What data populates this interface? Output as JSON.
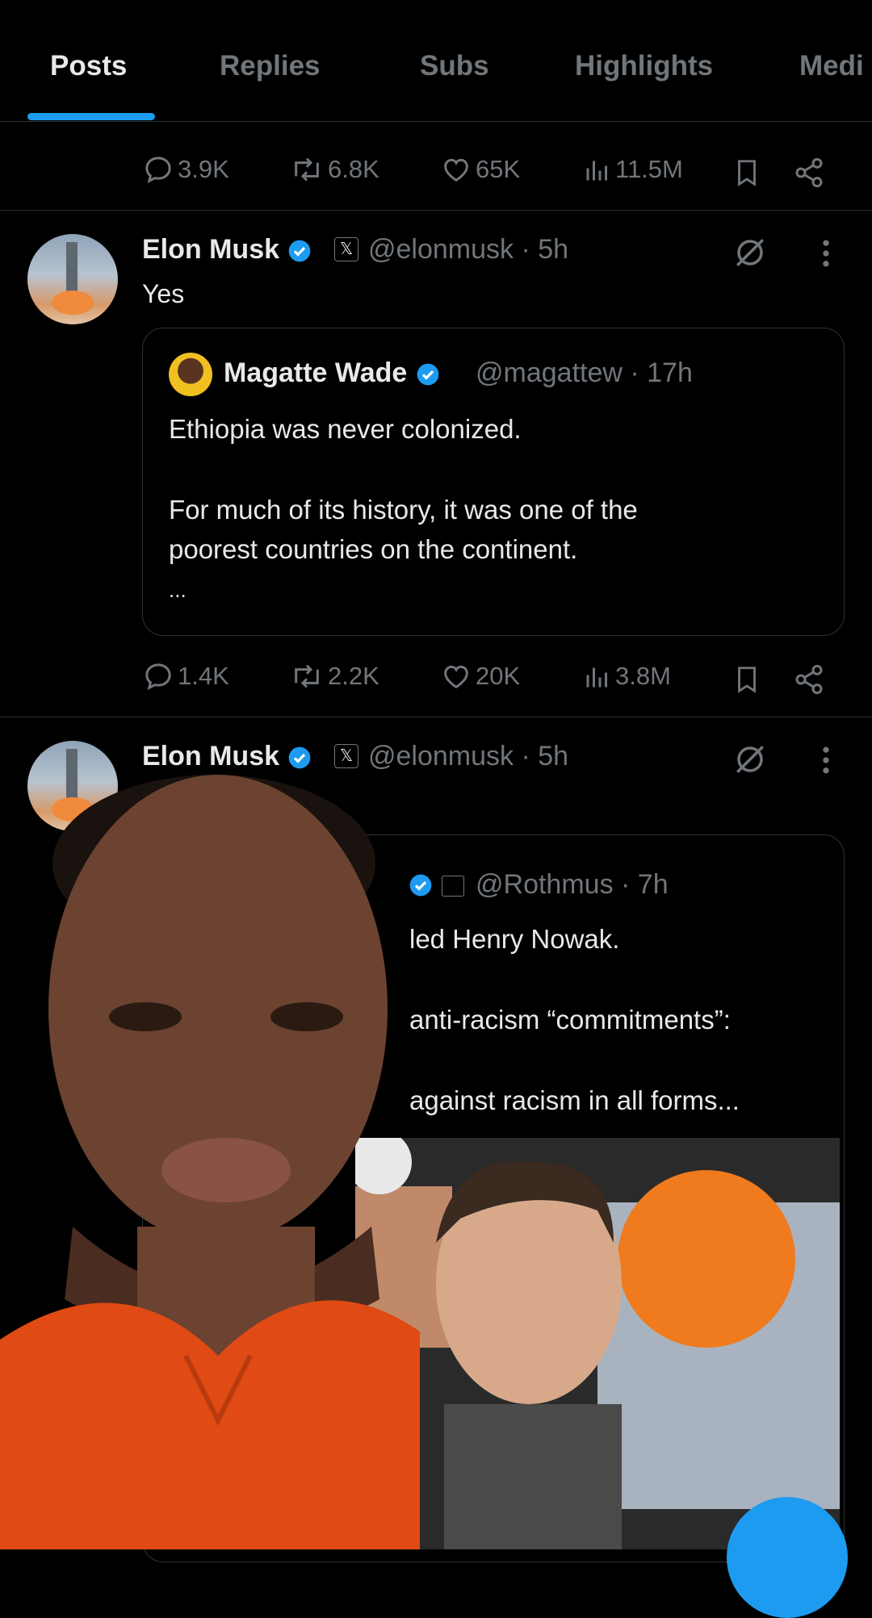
{
  "tabs": [
    {
      "label": "Posts",
      "active": true
    },
    {
      "label": "Replies",
      "active": false
    },
    {
      "label": "Subs",
      "active": false
    },
    {
      "label": "Highlights",
      "active": false
    },
    {
      "label": "Medi",
      "active": false
    }
  ],
  "top_actions": {
    "replies": "3.9K",
    "reposts": "6.8K",
    "likes": "65K",
    "views": "11.5M"
  },
  "tweet1": {
    "author": "Elon Musk",
    "handle": "@elonmusk",
    "time": "· 5h",
    "text": "Yes",
    "quote": {
      "author": "Magatte Wade",
      "handle": "@magattew",
      "time": "· 17h",
      "line1": "Ethiopia was never colonized.",
      "line2": "For much of its history, it was one of the",
      "line3": "poorest countries on the continent.",
      "line4": "..."
    },
    "actions": {
      "replies": "1.4K",
      "reposts": "2.2K",
      "likes": "20K",
      "views": "3.8M"
    }
  },
  "tweet2": {
    "author": "Elon Musk",
    "handle": "@elonmusk",
    "time": "· 5h",
    "quote": {
      "handle": "@Rothmus",
      "time": "· 7h",
      "line1": "led Henry Nowak.",
      "line2": "anti-racism “commitments”:",
      "line3": "against racism in all forms..."
    }
  },
  "colors": {
    "accent": "#1d9bf0",
    "muted": "#71767b",
    "text": "#e7e9ea",
    "background": "#000000"
  },
  "icons": [
    "reply-icon",
    "repost-icon",
    "like-icon",
    "views-icon",
    "bookmark-icon",
    "share-icon",
    "grok-icon",
    "more-icon",
    "verified-icon"
  ]
}
